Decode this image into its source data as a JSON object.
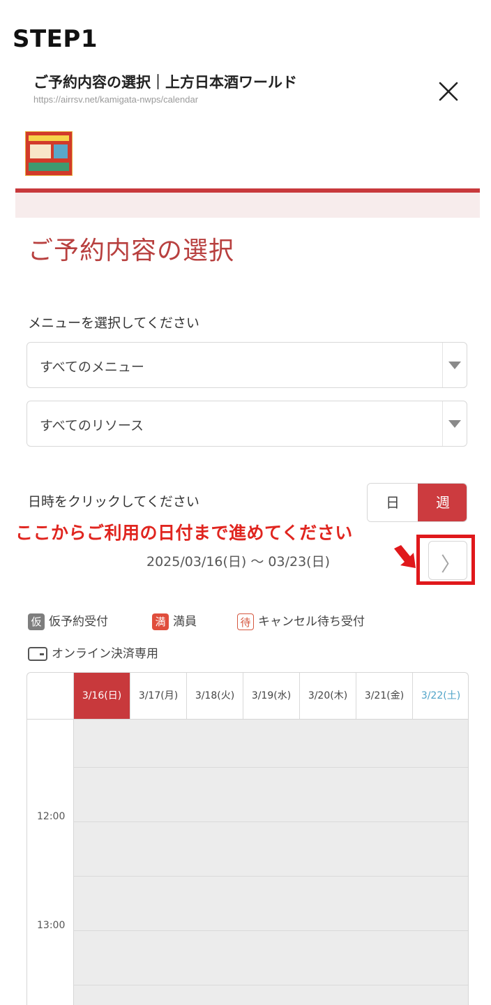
{
  "step_label": "STEP1",
  "browser": {
    "title": "ご予約内容の選択｜上方日本酒ワールド",
    "url": "https://airrsv.net/kamigata-nwps/calendar"
  },
  "page": {
    "heading": "ご予約内容の選択",
    "menu_label": "メニューを選択してください",
    "menu_select": "すべてのメニュー",
    "resource_select": "すべてのリソース",
    "datetime_label": "日時をクリックしてください",
    "view_toggle": {
      "day": "日",
      "week": "週",
      "active": "週"
    },
    "date_range": "2025/03/16(日) 〜 03/23(日)",
    "next_arrow": "〉"
  },
  "annotation": "ここからご利用の日付まで進めてください",
  "legend": [
    {
      "icon": "仮",
      "label": "仮予約受付"
    },
    {
      "icon": "満",
      "label": "満員"
    },
    {
      "icon": "待",
      "label": "キャンセル待ち受付"
    },
    {
      "icon": "card-icon",
      "label": "オンライン決済専用"
    }
  ],
  "calendar": {
    "days": [
      "3/16(日)",
      "3/17(月)",
      "3/18(火)",
      "3/19(水)",
      "3/20(木)",
      "3/21(金)",
      "3/22(土)"
    ],
    "selected_day": "3/16(日)",
    "times": [
      "12:00",
      "13:00"
    ]
  },
  "colors": {
    "accent": "#c8393c",
    "annotation_red": "#e0181b",
    "saturday_blue": "#4fa3c8"
  }
}
